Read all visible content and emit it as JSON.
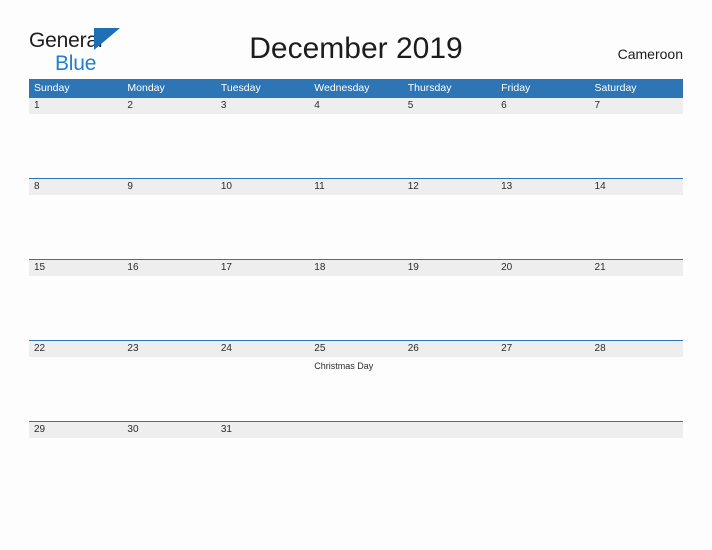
{
  "logo": {
    "word_top": "General",
    "word_bottom": "Blue",
    "triangle_icon": "logo-triangle-icon",
    "accent_color": "#1f7fd0"
  },
  "header": {
    "title": "December 2019",
    "country": "Cameroon"
  },
  "theme": {
    "header_blue": "#2e75b6",
    "band_gray": "#eeeeee",
    "page_background": "#fdfdfd",
    "text_color": "#2b2b2b"
  },
  "weekdays": [
    "Sunday",
    "Monday",
    "Tuesday",
    "Wednesday",
    "Thursday",
    "Friday",
    "Saturday"
  ],
  "weeks": [
    {
      "days": [
        {
          "number": "1",
          "event": ""
        },
        {
          "number": "2",
          "event": ""
        },
        {
          "number": "3",
          "event": ""
        },
        {
          "number": "4",
          "event": ""
        },
        {
          "number": "5",
          "event": ""
        },
        {
          "number": "6",
          "event": ""
        },
        {
          "number": "7",
          "event": ""
        }
      ]
    },
    {
      "days": [
        {
          "number": "8",
          "event": ""
        },
        {
          "number": "9",
          "event": ""
        },
        {
          "number": "10",
          "event": ""
        },
        {
          "number": "11",
          "event": ""
        },
        {
          "number": "12",
          "event": ""
        },
        {
          "number": "13",
          "event": ""
        },
        {
          "number": "14",
          "event": ""
        }
      ]
    },
    {
      "days": [
        {
          "number": "15",
          "event": ""
        },
        {
          "number": "16",
          "event": ""
        },
        {
          "number": "17",
          "event": ""
        },
        {
          "number": "18",
          "event": ""
        },
        {
          "number": "19",
          "event": ""
        },
        {
          "number": "20",
          "event": ""
        },
        {
          "number": "21",
          "event": ""
        }
      ]
    },
    {
      "days": [
        {
          "number": "22",
          "event": ""
        },
        {
          "number": "23",
          "event": ""
        },
        {
          "number": "24",
          "event": ""
        },
        {
          "number": "25",
          "event": "Christmas Day"
        },
        {
          "number": "26",
          "event": ""
        },
        {
          "number": "27",
          "event": ""
        },
        {
          "number": "28",
          "event": ""
        }
      ]
    },
    {
      "days": [
        {
          "number": "29",
          "event": ""
        },
        {
          "number": "30",
          "event": ""
        },
        {
          "number": "31",
          "event": ""
        },
        {
          "number": "",
          "event": ""
        },
        {
          "number": "",
          "event": ""
        },
        {
          "number": "",
          "event": ""
        },
        {
          "number": "",
          "event": ""
        }
      ]
    }
  ]
}
